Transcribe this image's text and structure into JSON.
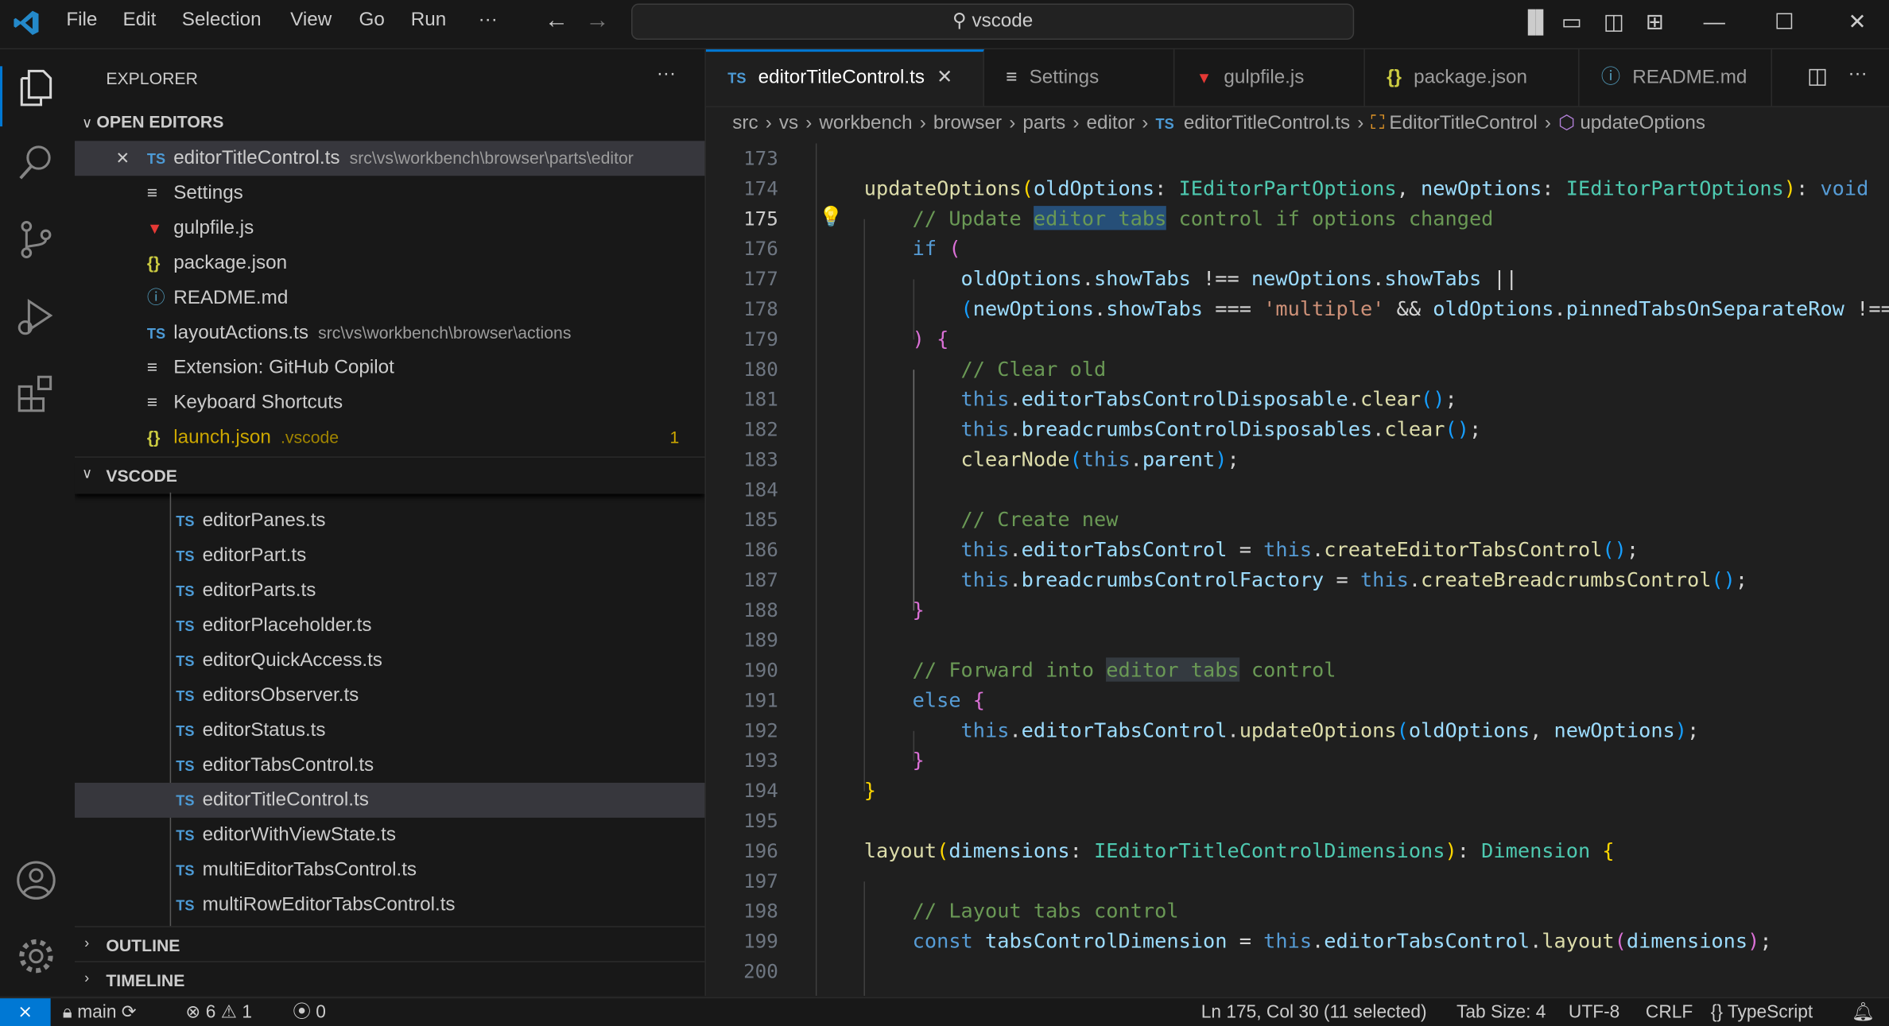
{
  "titlebar": {
    "menu": [
      "File",
      "Edit",
      "Selection",
      "View",
      "Go",
      "Run",
      "···"
    ],
    "search": "vscode"
  },
  "sidebar": {
    "title": "EXPLORER",
    "more": "···",
    "open_editors_label": "OPEN EDITORS",
    "open_editors": [
      {
        "icon": "ts",
        "name": "editorTitleControl.ts",
        "desc": "src\\vs\\workbench\\browser\\parts\\editor",
        "selected": true,
        "close": "✕"
      },
      {
        "icon": "settings",
        "name": "Settings"
      },
      {
        "icon": "gulp",
        "name": "gulpfile.js"
      },
      {
        "icon": "json",
        "name": "package.json"
      },
      {
        "icon": "info",
        "name": "README.md"
      },
      {
        "icon": "ts",
        "name": "layoutActions.ts",
        "desc": "src\\vs\\workbench\\browser\\actions"
      },
      {
        "icon": "settings",
        "name": "Extension: GitHub Copilot"
      },
      {
        "icon": "settings",
        "name": "Keyboard Shortcuts"
      },
      {
        "icon": "json",
        "name": "launch.json",
        "desc": ".vscode",
        "badge": "1",
        "modified": true
      }
    ],
    "folder_label": "VSCODE",
    "files": [
      "editorPanes.ts",
      "editorPart.ts",
      "editorParts.ts",
      "editorPlaceholder.ts",
      "editorQuickAccess.ts",
      "editorsObserver.ts",
      "editorStatus.ts",
      "editorTabsControl.ts",
      "editorTitleControl.ts",
      "editorWithViewState.ts",
      "multiEditorTabsControl.ts",
      "multiRowEditorTabsControl.ts"
    ],
    "selected_file": "editorTitleControl.ts",
    "outline_label": "OUTLINE",
    "timeline_label": "TIMELINE"
  },
  "tabs": [
    {
      "label": "editorTitleControl.ts",
      "icon": "TS",
      "active": true,
      "close": "✕"
    },
    {
      "label": "Settings",
      "icon": "≡"
    },
    {
      "label": "gulpfile.js",
      "icon": "gulp"
    },
    {
      "label": "package.json",
      "icon": "{}"
    },
    {
      "label": "README.md",
      "icon": "ⓘ"
    }
  ],
  "breadcrumbs": [
    "src",
    "vs",
    "workbench",
    "browser",
    "parts",
    "editor",
    "editorTitleControl.ts",
    "EditorTitleControl",
    "updateOptions"
  ],
  "editor": {
    "first_line": 173,
    "current_line": 175,
    "lines": [
      [],
      [
        [
          "p",
          "    "
        ],
        [
          "f",
          "updateOptions"
        ],
        [
          "b1",
          "("
        ],
        [
          "v",
          "oldOptions"
        ],
        [
          "p",
          ": "
        ],
        [
          "t",
          "IEditorPartOptions"
        ],
        [
          "p",
          ", "
        ],
        [
          "v",
          "newOptions"
        ],
        [
          "p",
          ": "
        ],
        [
          "t",
          "IEditorPartOptions"
        ],
        [
          "b1",
          ")"
        ],
        [
          "p",
          ": "
        ],
        [
          "k",
          "void"
        ]
      ],
      [
        [
          "p",
          "        "
        ],
        [
          "c",
          "// Update "
        ],
        [
          "c hl",
          "editor tabs"
        ],
        [
          "c",
          " control if options changed"
        ]
      ],
      [
        [
          "p",
          "        "
        ],
        [
          "k",
          "if"
        ],
        [
          "p",
          " "
        ],
        [
          "b2",
          "("
        ]
      ],
      [
        [
          "p",
          "            "
        ],
        [
          "v",
          "oldOptions"
        ],
        [
          "p",
          "."
        ],
        [
          "v",
          "showTabs"
        ],
        [
          "p",
          " !== "
        ],
        [
          "v",
          "newOptions"
        ],
        [
          "p",
          "."
        ],
        [
          "v",
          "showTabs"
        ],
        [
          "p",
          " ||"
        ]
      ],
      [
        [
          "p",
          "            "
        ],
        [
          "b3",
          "("
        ],
        [
          "v",
          "newOptions"
        ],
        [
          "p",
          "."
        ],
        [
          "v",
          "showTabs"
        ],
        [
          "p",
          " === "
        ],
        [
          "s",
          "'multiple'"
        ],
        [
          "p",
          " && "
        ],
        [
          "v",
          "oldOptions"
        ],
        [
          "p",
          "."
        ],
        [
          "v",
          "pinnedTabsOnSeparateRow"
        ],
        [
          "p",
          " !=="
        ]
      ],
      [
        [
          "p",
          "        "
        ],
        [
          "b2",
          ")"
        ],
        [
          "p",
          " "
        ],
        [
          "b2",
          "{"
        ]
      ],
      [
        [
          "p",
          "            "
        ],
        [
          "c",
          "// Clear old"
        ]
      ],
      [
        [
          "p",
          "            "
        ],
        [
          "k",
          "this"
        ],
        [
          "p",
          "."
        ],
        [
          "v",
          "editorTabsControlDisposable"
        ],
        [
          "p",
          "."
        ],
        [
          "f",
          "clear"
        ],
        [
          "b3",
          "()"
        ],
        [
          "p",
          ";"
        ]
      ],
      [
        [
          "p",
          "            "
        ],
        [
          "k",
          "this"
        ],
        [
          "p",
          "."
        ],
        [
          "v",
          "breadcrumbsControlDisposables"
        ],
        [
          "p",
          "."
        ],
        [
          "f",
          "clear"
        ],
        [
          "b3",
          "()"
        ],
        [
          "p",
          ";"
        ]
      ],
      [
        [
          "p",
          "            "
        ],
        [
          "f",
          "clearNode"
        ],
        [
          "b3",
          "("
        ],
        [
          "k",
          "this"
        ],
        [
          "p",
          "."
        ],
        [
          "v",
          "parent"
        ],
        [
          "b3",
          ")"
        ],
        [
          "p",
          ";"
        ]
      ],
      [],
      [
        [
          "p",
          "            "
        ],
        [
          "c",
          "// Create new"
        ]
      ],
      [
        [
          "p",
          "            "
        ],
        [
          "k",
          "this"
        ],
        [
          "p",
          "."
        ],
        [
          "v",
          "editorTabsControl"
        ],
        [
          "p",
          " = "
        ],
        [
          "k",
          "this"
        ],
        [
          "p",
          "."
        ],
        [
          "f",
          "createEditorTabsControl"
        ],
        [
          "b3",
          "()"
        ],
        [
          "p",
          ";"
        ]
      ],
      [
        [
          "p",
          "            "
        ],
        [
          "k",
          "this"
        ],
        [
          "p",
          "."
        ],
        [
          "v",
          "breadcrumbsControlFactory"
        ],
        [
          "p",
          " = "
        ],
        [
          "k",
          "this"
        ],
        [
          "p",
          "."
        ],
        [
          "f",
          "createBreadcrumbsControl"
        ],
        [
          "b3",
          "()"
        ],
        [
          "p",
          ";"
        ]
      ],
      [
        [
          "p",
          "        "
        ],
        [
          "b2",
          "}"
        ]
      ],
      [],
      [
        [
          "p",
          "        "
        ],
        [
          "c",
          "// Forward into "
        ],
        [
          "c hl2",
          "editor tabs"
        ],
        [
          "c",
          " control"
        ]
      ],
      [
        [
          "p",
          "        "
        ],
        [
          "k",
          "else"
        ],
        [
          "p",
          " "
        ],
        [
          "b2",
          "{"
        ]
      ],
      [
        [
          "p",
          "            "
        ],
        [
          "k",
          "this"
        ],
        [
          "p",
          "."
        ],
        [
          "v",
          "editorTabsControl"
        ],
        [
          "p",
          "."
        ],
        [
          "f",
          "updateOptions"
        ],
        [
          "b3",
          "("
        ],
        [
          "v",
          "oldOptions"
        ],
        [
          "p",
          ", "
        ],
        [
          "v",
          "newOptions"
        ],
        [
          "b3",
          ")"
        ],
        [
          "p",
          ";"
        ]
      ],
      [
        [
          "p",
          "        "
        ],
        [
          "b2",
          "}"
        ]
      ],
      [
        [
          "p",
          "    "
        ],
        [
          "b1",
          "}"
        ]
      ],
      [],
      [
        [
          "p",
          "    "
        ],
        [
          "f",
          "layout"
        ],
        [
          "b1",
          "("
        ],
        [
          "v",
          "dimensions"
        ],
        [
          "p",
          ": "
        ],
        [
          "t",
          "IEditorTitleControlDimensions"
        ],
        [
          "b1",
          ")"
        ],
        [
          "p",
          ": "
        ],
        [
          "t",
          "Dimension"
        ],
        [
          "p",
          " "
        ],
        [
          "b1",
          "{"
        ]
      ],
      [],
      [
        [
          "p",
          "        "
        ],
        [
          "c",
          "// Layout tabs control"
        ]
      ],
      [
        [
          "p",
          "        "
        ],
        [
          "k",
          "const"
        ],
        [
          "p",
          " "
        ],
        [
          "v",
          "tabsControlDimension"
        ],
        [
          "p",
          " = "
        ],
        [
          "k",
          "this"
        ],
        [
          "p",
          "."
        ],
        [
          "v",
          "editorTabsControl"
        ],
        [
          "p",
          "."
        ],
        [
          "f",
          "layout"
        ],
        [
          "b2",
          "("
        ],
        [
          "v",
          "dimensions"
        ],
        [
          "b2",
          ")"
        ],
        [
          "p",
          ";"
        ]
      ],
      []
    ]
  },
  "status": {
    "branch": "main",
    "errors": "6",
    "warnings": "1",
    "ports": "0",
    "position": "Ln 175, Col 30 (11 selected)",
    "tab_size": "Tab Size: 4",
    "encoding": "UTF-8",
    "eol": "CRLF",
    "language": "TypeScript"
  },
  "colors": {
    "accent": "#0078d4",
    "background": "#1f1f1f",
    "sidebar": "#181818"
  }
}
